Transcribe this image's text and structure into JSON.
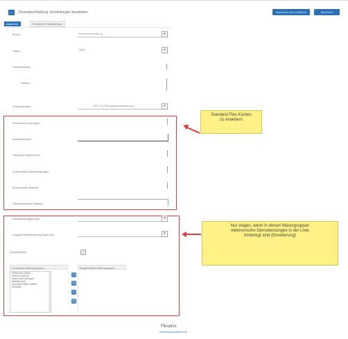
{
  "header": {
    "back_glyph": "←",
    "title": "Finanzbuchhaltung: Einstellungen bearbeiten",
    "save_close_label": "Speichern und schließen",
    "save_label": "Speichern"
  },
  "tabs": [
    {
      "label": "Allgemein",
      "active": true
    },
    {
      "label": "Erweiterte Einstellungen",
      "active": false
    }
  ],
  "form": {
    "row1": {
      "label": "Modul",
      "value": "Finanzbuchhaltung"
    },
    "row2": {
      "label": "Status",
      "value": "Aktiv"
    },
    "row3": {
      "label": "Standardwerte"
    },
    "row4": {
      "label": "Notizen"
    },
    "row5": {
      "label": "Kontenrahmen",
      "value": "SKR 03 (Standardkontenrahmen)"
    }
  },
  "section1": {
    "fields": [
      {
        "label": "Erlöskonto Leistungen"
      },
      {
        "label": "Aufwandskonto"
      },
      {
        "label": "Standard-Gegenkonto"
      },
      {
        "label": "Kostenstelle Dienstleistungen"
      },
      {
        "label": "Kostenstelle Material"
      },
      {
        "label": "Steuerschlüssel Ausland"
      }
    ],
    "note": "Standard Fibu Konten\nzu erweitern"
  },
  "section2": {
    "row1": {
      "label": "Dienstleistungsgruppe"
    },
    "row2": {
      "label": "Vorgabe Dienstleistung Elektronik"
    },
    "row3": {
      "label": "Einschränken"
    },
    "list_left_header": "Verfügbare Warengruppen",
    "list_right_header": "Ausgewählte Warengruppen",
    "list_items": [
      "Elektronik Geräte",
      "Elektro-Zubehör",
      "Kabel und Leitungen",
      "Messtechnik",
      "Sonstige Elektro-Artikel",
      "Software"
    ],
    "note": "Nur zeigen, wenn in diesen Warengruppen\nelektronische Dienstleistungen in der Liste\nhinterlegt sind (Erweiterung)"
  },
  "footer": {
    "brand": "Fibuplus",
    "link": "www.fibuplus-software.de"
  },
  "colors": {
    "accent": "#2a6fb8",
    "annotation_red": "#e23b3b",
    "note_yellow": "#fff185"
  },
  "icons": {
    "dropdown": "chevron-down-icon",
    "move_right": "arrow-right-icon",
    "move_left": "arrow-left-icon"
  }
}
